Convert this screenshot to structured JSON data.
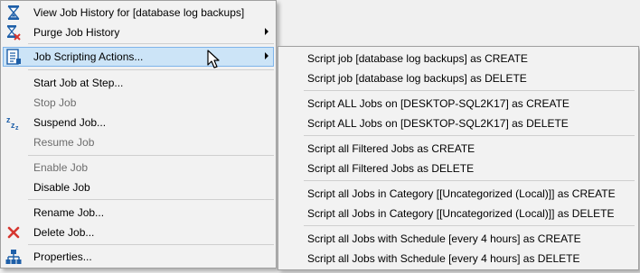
{
  "main_menu": {
    "items": [
      {
        "label": "View Job History for [database log backups]"
      },
      {
        "label": "Purge Job History"
      },
      {
        "label": "Job Scripting Actions..."
      },
      {
        "label": "Start Job at Step..."
      },
      {
        "label": "Stop Job"
      },
      {
        "label": "Suspend Job..."
      },
      {
        "label": "Resume Job"
      },
      {
        "label": "Enable Job"
      },
      {
        "label": "Disable Job"
      },
      {
        "label": "Rename Job..."
      },
      {
        "label": "Delete Job..."
      },
      {
        "label": "Properties..."
      }
    ]
  },
  "sub_menu": {
    "items": [
      {
        "label": "Script job [database log backups] as CREATE"
      },
      {
        "label": "Script job [database log backups] as DELETE"
      },
      {
        "label": "Script ALL Jobs on [DESKTOP-SQL2K17] as CREATE"
      },
      {
        "label": "Script ALL Jobs on [DESKTOP-SQL2K17] as DELETE"
      },
      {
        "label": "Script all Filtered Jobs as CREATE"
      },
      {
        "label": "Script all Filtered Jobs as DELETE"
      },
      {
        "label": "Script all Jobs in Category [[Uncategorized (Local)]] as CREATE"
      },
      {
        "label": "Script all Jobs in Category [[Uncategorized (Local)]] as DELETE"
      },
      {
        "label": "Script all Jobs with Schedule [every 4 hours] as CREATE"
      },
      {
        "label": "Script all Jobs with Schedule [every 4 hours] as DELETE"
      }
    ]
  },
  "colors": {
    "highlight_bg": "#cce4f7",
    "highlight_border": "#7eb4ea",
    "disabled_text": "#6d6d6d",
    "delete_icon": "#d6362f",
    "icon_blue": "#1e5fa8"
  },
  "icons": [
    "hourglass-icon",
    "purge-history-icon",
    "script-icon",
    "suspend-icon",
    "delete-icon",
    "properties-icon",
    "mouse-cursor-icon"
  ]
}
